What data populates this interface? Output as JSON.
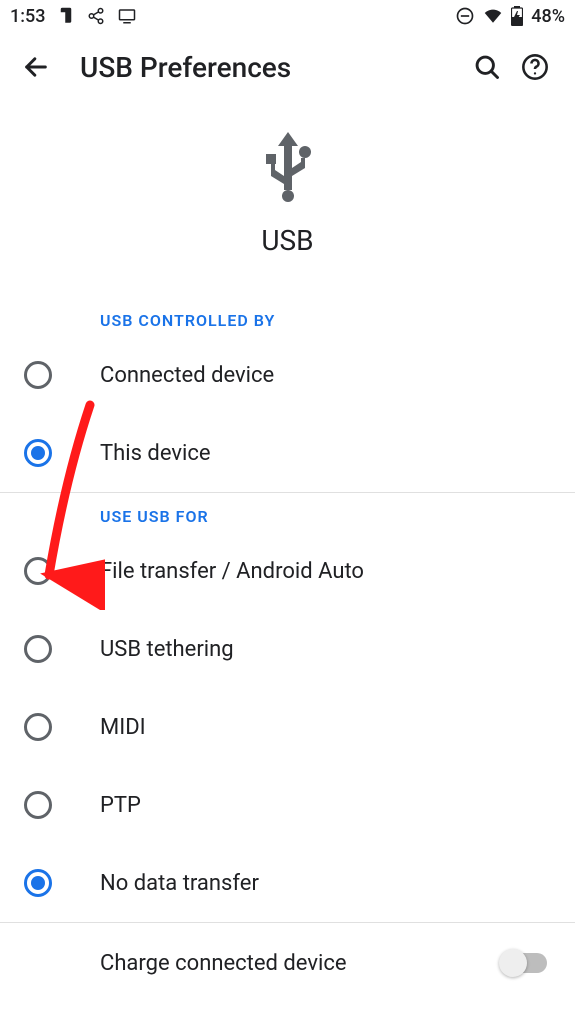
{
  "status": {
    "time": "1:53",
    "battery": "48%"
  },
  "appbar": {
    "title": "USB Preferences"
  },
  "hero": {
    "label": "USB"
  },
  "section1": {
    "header": "USB CONTROLLED BY",
    "options": {
      "connected_device": "Connected device",
      "this_device": "This device"
    }
  },
  "section2": {
    "header": "USE USB FOR",
    "options": {
      "file_transfer": "File transfer / Android Auto",
      "usb_tethering": "USB tethering",
      "midi": "MIDI",
      "ptp": "PTP",
      "no_data": "No data transfer"
    }
  },
  "charge": {
    "label": "Charge connected device"
  }
}
